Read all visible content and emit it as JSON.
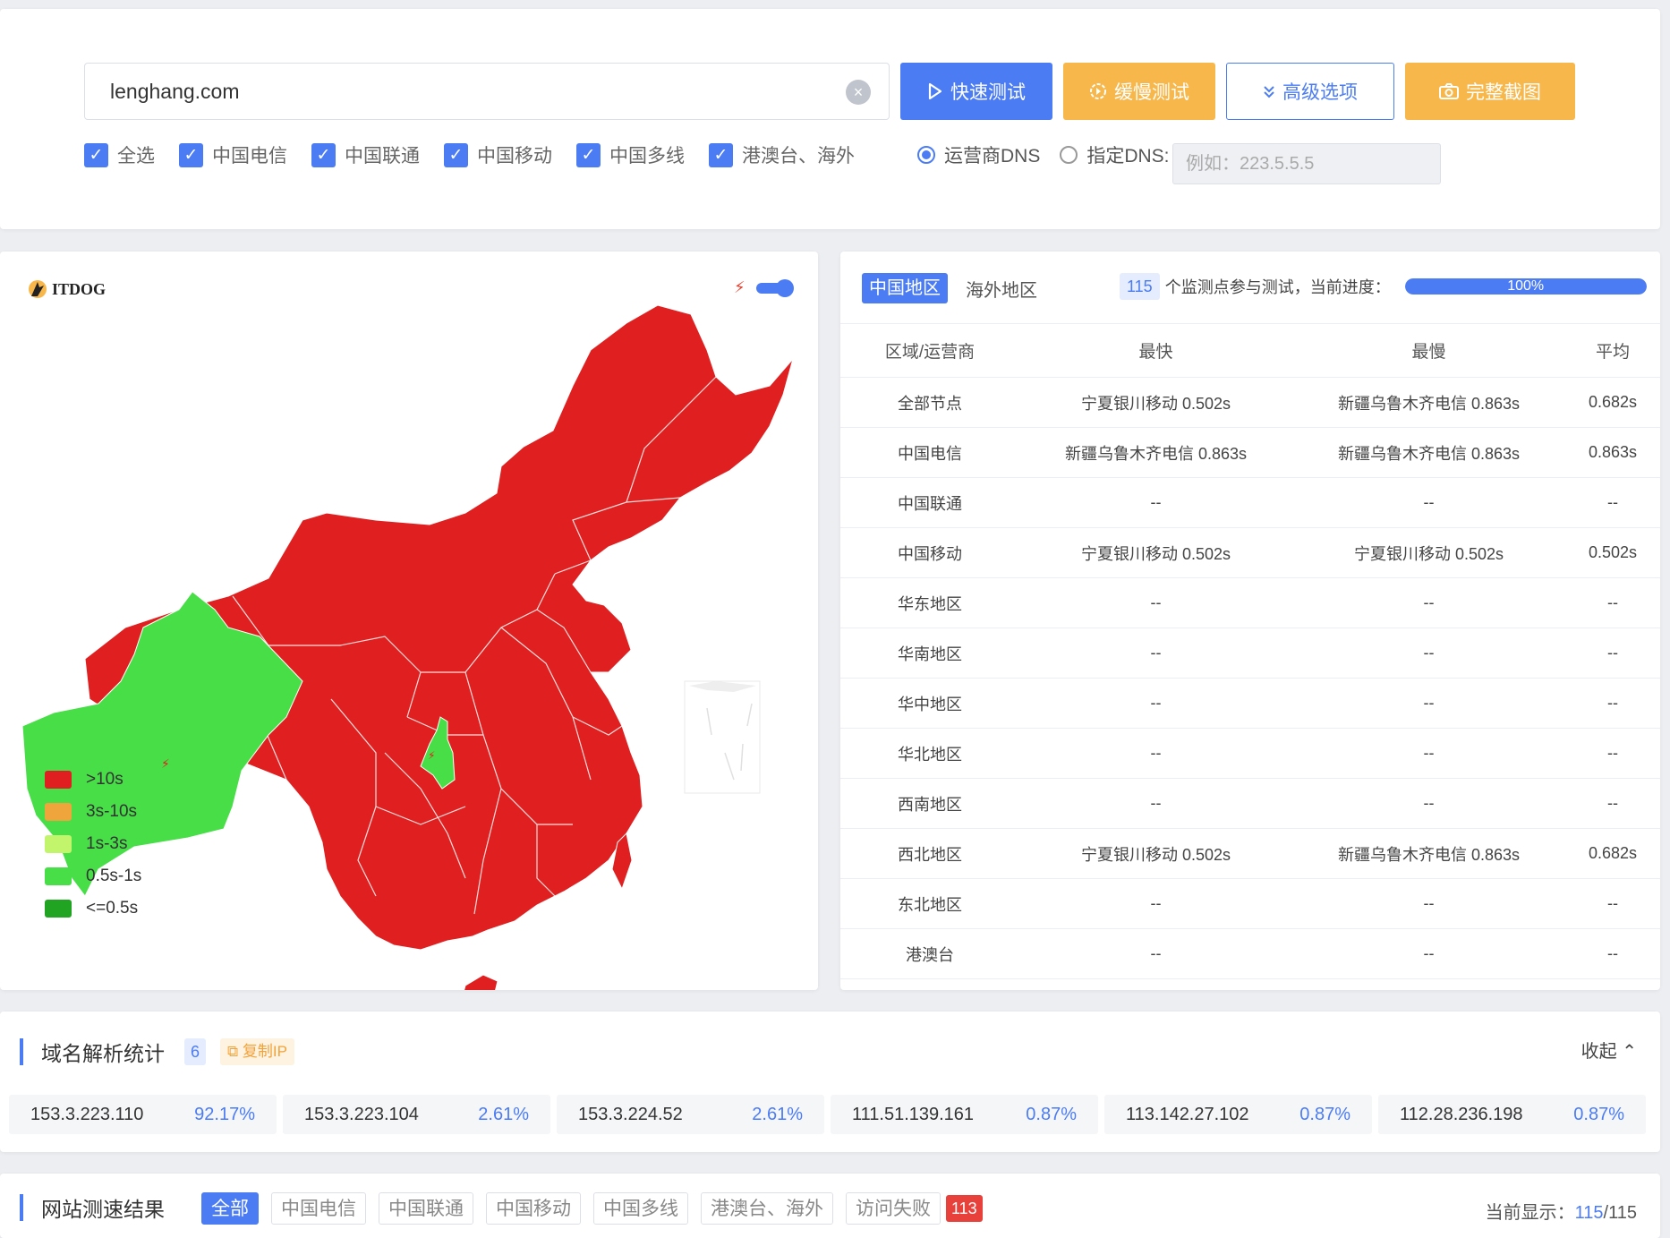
{
  "search": {
    "url_value": "lenghang.com",
    "clear_icon": "×"
  },
  "buttons": {
    "quick_test": "快速测试",
    "slow_test": "缓慢测试",
    "advanced": "高级选项",
    "screenshot": "完整截图"
  },
  "filters": {
    "select_all": "全选",
    "telecom": "中国电信",
    "unicom": "中国联通",
    "mobile": "中国移动",
    "multi": "中国多线",
    "overseas": "港澳台、海外"
  },
  "dns": {
    "carrier_dns": "运营商DNS",
    "custom_dns": "指定DNS:",
    "placeholder": "例如：223.5.5.5"
  },
  "map": {
    "logo_text": "ITDOG",
    "legend": [
      {
        "label": ">10s",
        "color": "#e02020"
      },
      {
        "label": "3s-10s",
        "color": "#f0a43c"
      },
      {
        "label": "1s-3s",
        "color": "#c2f56c"
      },
      {
        "label": "0.5s-1s",
        "color": "#47de47"
      },
      {
        "label": "<=0.5s",
        "color": "#21a421"
      }
    ]
  },
  "stats": {
    "tab_china": "中国地区",
    "tab_overseas": "海外地区",
    "node_count": "115",
    "progress_label": "个监测点参与测试，当前进度：",
    "progress_value": "100%",
    "progress_fraction": 1.0,
    "headers": [
      "区域/运营商",
      "最快",
      "最慢",
      "平均"
    ],
    "rows": [
      [
        "全部节点",
        "宁夏银川移动 0.502s",
        "新疆乌鲁木齐电信 0.863s",
        "0.682s"
      ],
      [
        "中国电信",
        "新疆乌鲁木齐电信 0.863s",
        "新疆乌鲁木齐电信 0.863s",
        "0.863s"
      ],
      [
        "中国联通",
        "--",
        "--",
        "--"
      ],
      [
        "中国移动",
        "宁夏银川移动 0.502s",
        "宁夏银川移动 0.502s",
        "0.502s"
      ],
      [
        "华东地区",
        "--",
        "--",
        "--"
      ],
      [
        "华南地区",
        "--",
        "--",
        "--"
      ],
      [
        "华中地区",
        "--",
        "--",
        "--"
      ],
      [
        "华北地区",
        "--",
        "--",
        "--"
      ],
      [
        "西南地区",
        "--",
        "--",
        "--"
      ],
      [
        "西北地区",
        "宁夏银川移动 0.502s",
        "新疆乌鲁木齐电信 0.863s",
        "0.682s"
      ],
      [
        "东北地区",
        "--",
        "--",
        "--"
      ],
      [
        "港澳台",
        "--",
        "--",
        "--"
      ]
    ]
  },
  "dns_stats": {
    "title": "域名解析统计",
    "count": "6",
    "copy_ip": "复制IP",
    "collapse": "收起",
    "ips": [
      {
        "ip": "153.3.223.110",
        "pct": "92.17%"
      },
      {
        "ip": "153.3.223.104",
        "pct": "2.61%"
      },
      {
        "ip": "153.3.224.52",
        "pct": "2.61%"
      },
      {
        "ip": "111.51.139.161",
        "pct": "0.87%"
      },
      {
        "ip": "113.142.27.102",
        "pct": "0.87%"
      },
      {
        "ip": "112.28.236.198",
        "pct": "0.87%"
      }
    ]
  },
  "results": {
    "title": "网站测速结果",
    "filters": [
      "全部",
      "中国电信",
      "中国联通",
      "中国移动",
      "中国多线",
      "港澳台、海外"
    ],
    "fail_label": "访问失败",
    "fail_count": "113",
    "display_label": "当前显示：",
    "display_shown": "115",
    "display_total": "/115"
  }
}
